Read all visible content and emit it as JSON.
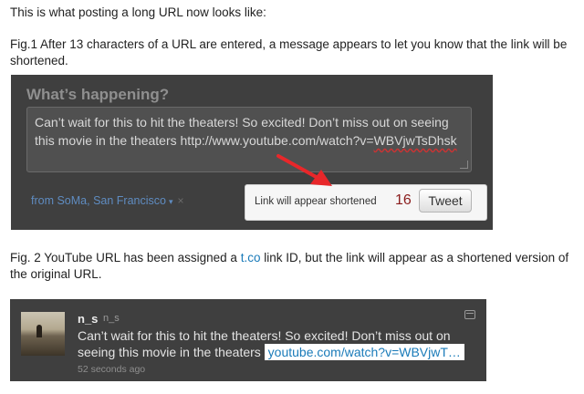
{
  "intro": "This is what posting a long URL now looks like:",
  "fig1": {
    "caption": "Fig.1 After 13 characters of a URL are entered, a message appears to let you know that the link will be shortened.",
    "title": "What’s happening?",
    "tweet_text_line1": "Can’t wait for this to hit the theaters! So excited! Don’t miss out on seeing",
    "tweet_text_line2_prefix": "this movie in the theaters http://www.youtube.com/watch?v=",
    "tweet_text_line2_underlined": "WBVjwTsDhsk",
    "location": "from SoMa, San Francisco",
    "location_caret": "▾",
    "location_close": "×",
    "notice": "Link will appear shortened",
    "char_count": "16",
    "tweet_button": "Tweet",
    "arrow_color": "#e8272a"
  },
  "fig2": {
    "caption_before": "Fig. 2  YouTube URL has been assigned a ",
    "caption_link": "t.co",
    "caption_after": " link ID, but the link will appear as a shortened version of the original URL.",
    "screen_name": "n_s",
    "handle": "n_s",
    "text_line1": "Can’t wait for this to hit the theaters! So excited! Don’t miss out on",
    "text_line2": "seeing this movie in the theaters ",
    "link": "youtube.com/watch?v=WBVjwT…",
    "timestamp": "52 seconds ago"
  }
}
